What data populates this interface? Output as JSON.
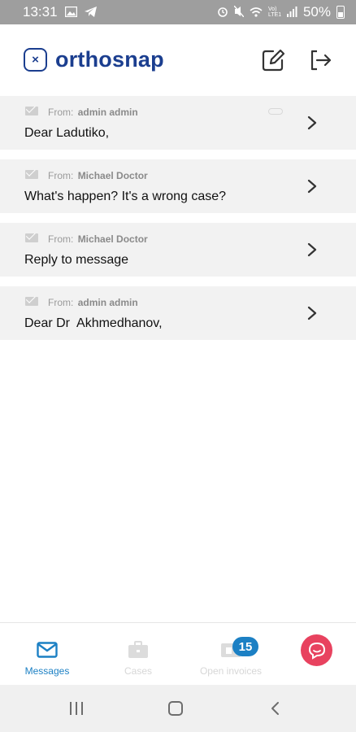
{
  "status_bar": {
    "time": "13:31",
    "battery": "50%",
    "network_label": "Vo) LTE1"
  },
  "header": {
    "brand": "orthosnap"
  },
  "messages": [
    {
      "from_prefix": "From:",
      "from": "admin admin",
      "subject": "Dear Ladutiko,",
      "has_attachment": true
    },
    {
      "from_prefix": "From:",
      "from": "Michael Doctor",
      "subject": "What's happen? It's a wrong case?",
      "has_attachment": false
    },
    {
      "from_prefix": "From:",
      "from": "Michael Doctor",
      "subject": "Reply to message",
      "has_attachment": false
    },
    {
      "from_prefix": "From:",
      "from": "admin admin",
      "subject": "Dear Dr  Akhmedhanov,",
      "has_attachment": false
    }
  ],
  "tabs": [
    {
      "label": "Messages",
      "active": true
    },
    {
      "label": "Cases",
      "active": false
    },
    {
      "label": "Open invoices",
      "active": false,
      "badge": "15"
    }
  ],
  "colors": {
    "brand": "#1b3e8f",
    "accent": "#1c80c4",
    "chat_fab": "#e8425f",
    "list_row_bg": "#f2f2f2"
  },
  "icons": [
    "gallery-icon",
    "telegram-icon",
    "alarm-icon",
    "mute-icon",
    "wifi-icon",
    "signal-icon",
    "battery-icon",
    "compose-icon",
    "logout-icon",
    "envelope-icon",
    "chevron-right-icon",
    "attachment-icon",
    "briefcase-icon",
    "invoice-icon",
    "chat-icon",
    "recent-apps-icon",
    "home-icon",
    "back-icon"
  ]
}
